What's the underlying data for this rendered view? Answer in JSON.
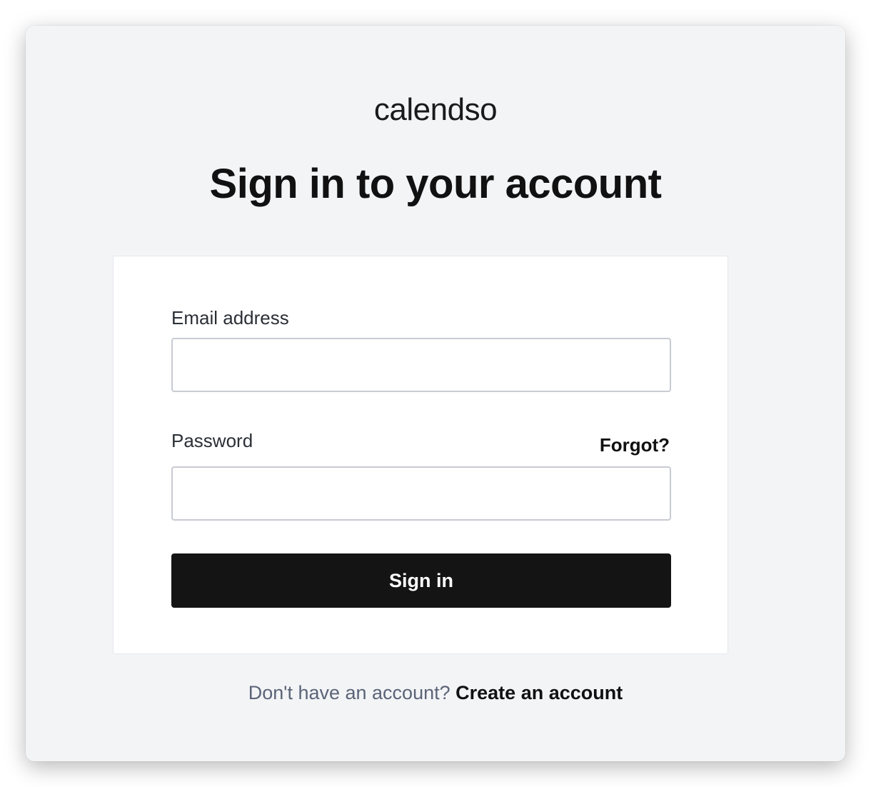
{
  "brand": {
    "logo_text": "calendso"
  },
  "header": {
    "title": "Sign in to your account"
  },
  "form": {
    "email": {
      "label": "Email address",
      "value": "",
      "placeholder": ""
    },
    "password": {
      "label": "Password",
      "value": "",
      "placeholder": ""
    },
    "forgot_label": "Forgot?",
    "submit_label": "Sign in"
  },
  "footer": {
    "prompt": "Don't have an account?",
    "link": "Create an account"
  },
  "colors": {
    "page_background": "#f3f4f6",
    "card_background": "#ffffff",
    "primary_button": "#141414",
    "muted_text": "#5b6478"
  }
}
